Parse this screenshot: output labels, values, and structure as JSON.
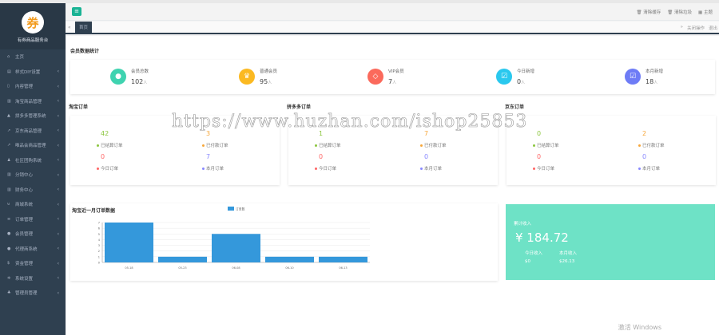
{
  "sidebar": {
    "site_title": "有券商品服务台",
    "logo_char": "券",
    "items": [
      {
        "label": "主页",
        "icon": "home-icon"
      },
      {
        "label": "样式DIY设置",
        "icon": "layout-icon"
      },
      {
        "label": "内容管理",
        "icon": "file-icon"
      },
      {
        "label": "淘宝商品管理",
        "icon": "bar-chart-icon"
      },
      {
        "label": "拼多多管理系统",
        "icon": "area-chart-icon"
      },
      {
        "label": "京东商品管理",
        "icon": "line-chart-icon"
      },
      {
        "label": "唯品会商品管理",
        "icon": "line-chart-icon"
      },
      {
        "label": "社区团购系统",
        "icon": "group-icon"
      },
      {
        "label": "分销中心",
        "icon": "bar-chart-icon"
      },
      {
        "label": "财务中心",
        "icon": "bar-chart-icon"
      },
      {
        "label": "商城系统",
        "icon": "cart-icon"
      },
      {
        "label": "订单管理",
        "icon": "list-icon"
      },
      {
        "label": "会员管理",
        "icon": "user-icon"
      },
      {
        "label": "代理商系统",
        "icon": "user-icon"
      },
      {
        "label": "资金管理",
        "icon": "dollar-icon"
      },
      {
        "label": "系统设置",
        "icon": "gear-icon"
      },
      {
        "label": "管理员管理",
        "icon": "users-icon"
      }
    ]
  },
  "topbar": {
    "clear_cache": "清除缓存",
    "clear_trash": "清除垃圾",
    "theme": "主题"
  },
  "tabs": {
    "home": "首页",
    "close_ops": "关闭操作",
    "logout": "退出"
  },
  "member_stats": {
    "title": "会员数据统计",
    "unit": "人",
    "items": [
      {
        "label": "会员总数",
        "value": "102",
        "color": "#3fd3b0",
        "icon": "user-icon"
      },
      {
        "label": "普通会员",
        "value": "95",
        "color": "#fbb921",
        "icon": "crown-icon"
      },
      {
        "label": "VIP会员",
        "value": "7",
        "color": "#fb6a5c",
        "icon": "diamond-icon"
      },
      {
        "label": "今日新增",
        "value": "0",
        "color": "#2ac8ee",
        "icon": "calendar-check-icon"
      },
      {
        "label": "本月新增",
        "value": "18",
        "color": "#6e7cf6",
        "icon": "calendar-check-icon"
      }
    ]
  },
  "orders": {
    "labels": {
      "paid": "已结算订单",
      "pending": "已付款订单",
      "today": "今日订单",
      "month": "本月订单"
    },
    "colors": {
      "paid": "#8cc63f",
      "pending": "#f7a73a",
      "today": "#f66",
      "month": "#88f"
    },
    "groups": [
      {
        "title": "淘宝订单",
        "paid": "42",
        "pending": "3",
        "today": "0",
        "month": "7"
      },
      {
        "title": "拼多多订单",
        "paid": "1",
        "pending": "7",
        "today": "0",
        "month": "0"
      },
      {
        "title": "京东订单",
        "paid": "0",
        "pending": "2",
        "today": "0",
        "month": "0"
      }
    ]
  },
  "chart_data": {
    "type": "bar",
    "title": "淘宝近一月订单数据",
    "legend": [
      "订单数"
    ],
    "legend_position": "top",
    "categories": [
      "05-18",
      "05-23",
      "06-08",
      "06-10",
      "06-13"
    ],
    "values": [
      7,
      1,
      5,
      1,
      1
    ],
    "ylim": [
      0,
      7
    ],
    "yticks": [
      0,
      1,
      2,
      3,
      4,
      5,
      6,
      7
    ],
    "color": "#3498db",
    "grid": true
  },
  "income": {
    "title": "累计收入",
    "total": "¥ 184.72",
    "today_label": "今日收入",
    "today_value": "$0",
    "month_label": "本月收入",
    "month_value": "$26.13"
  },
  "watermark": "https://www.huzhan.com/ishop25853",
  "os_notice": "激活 Windows"
}
